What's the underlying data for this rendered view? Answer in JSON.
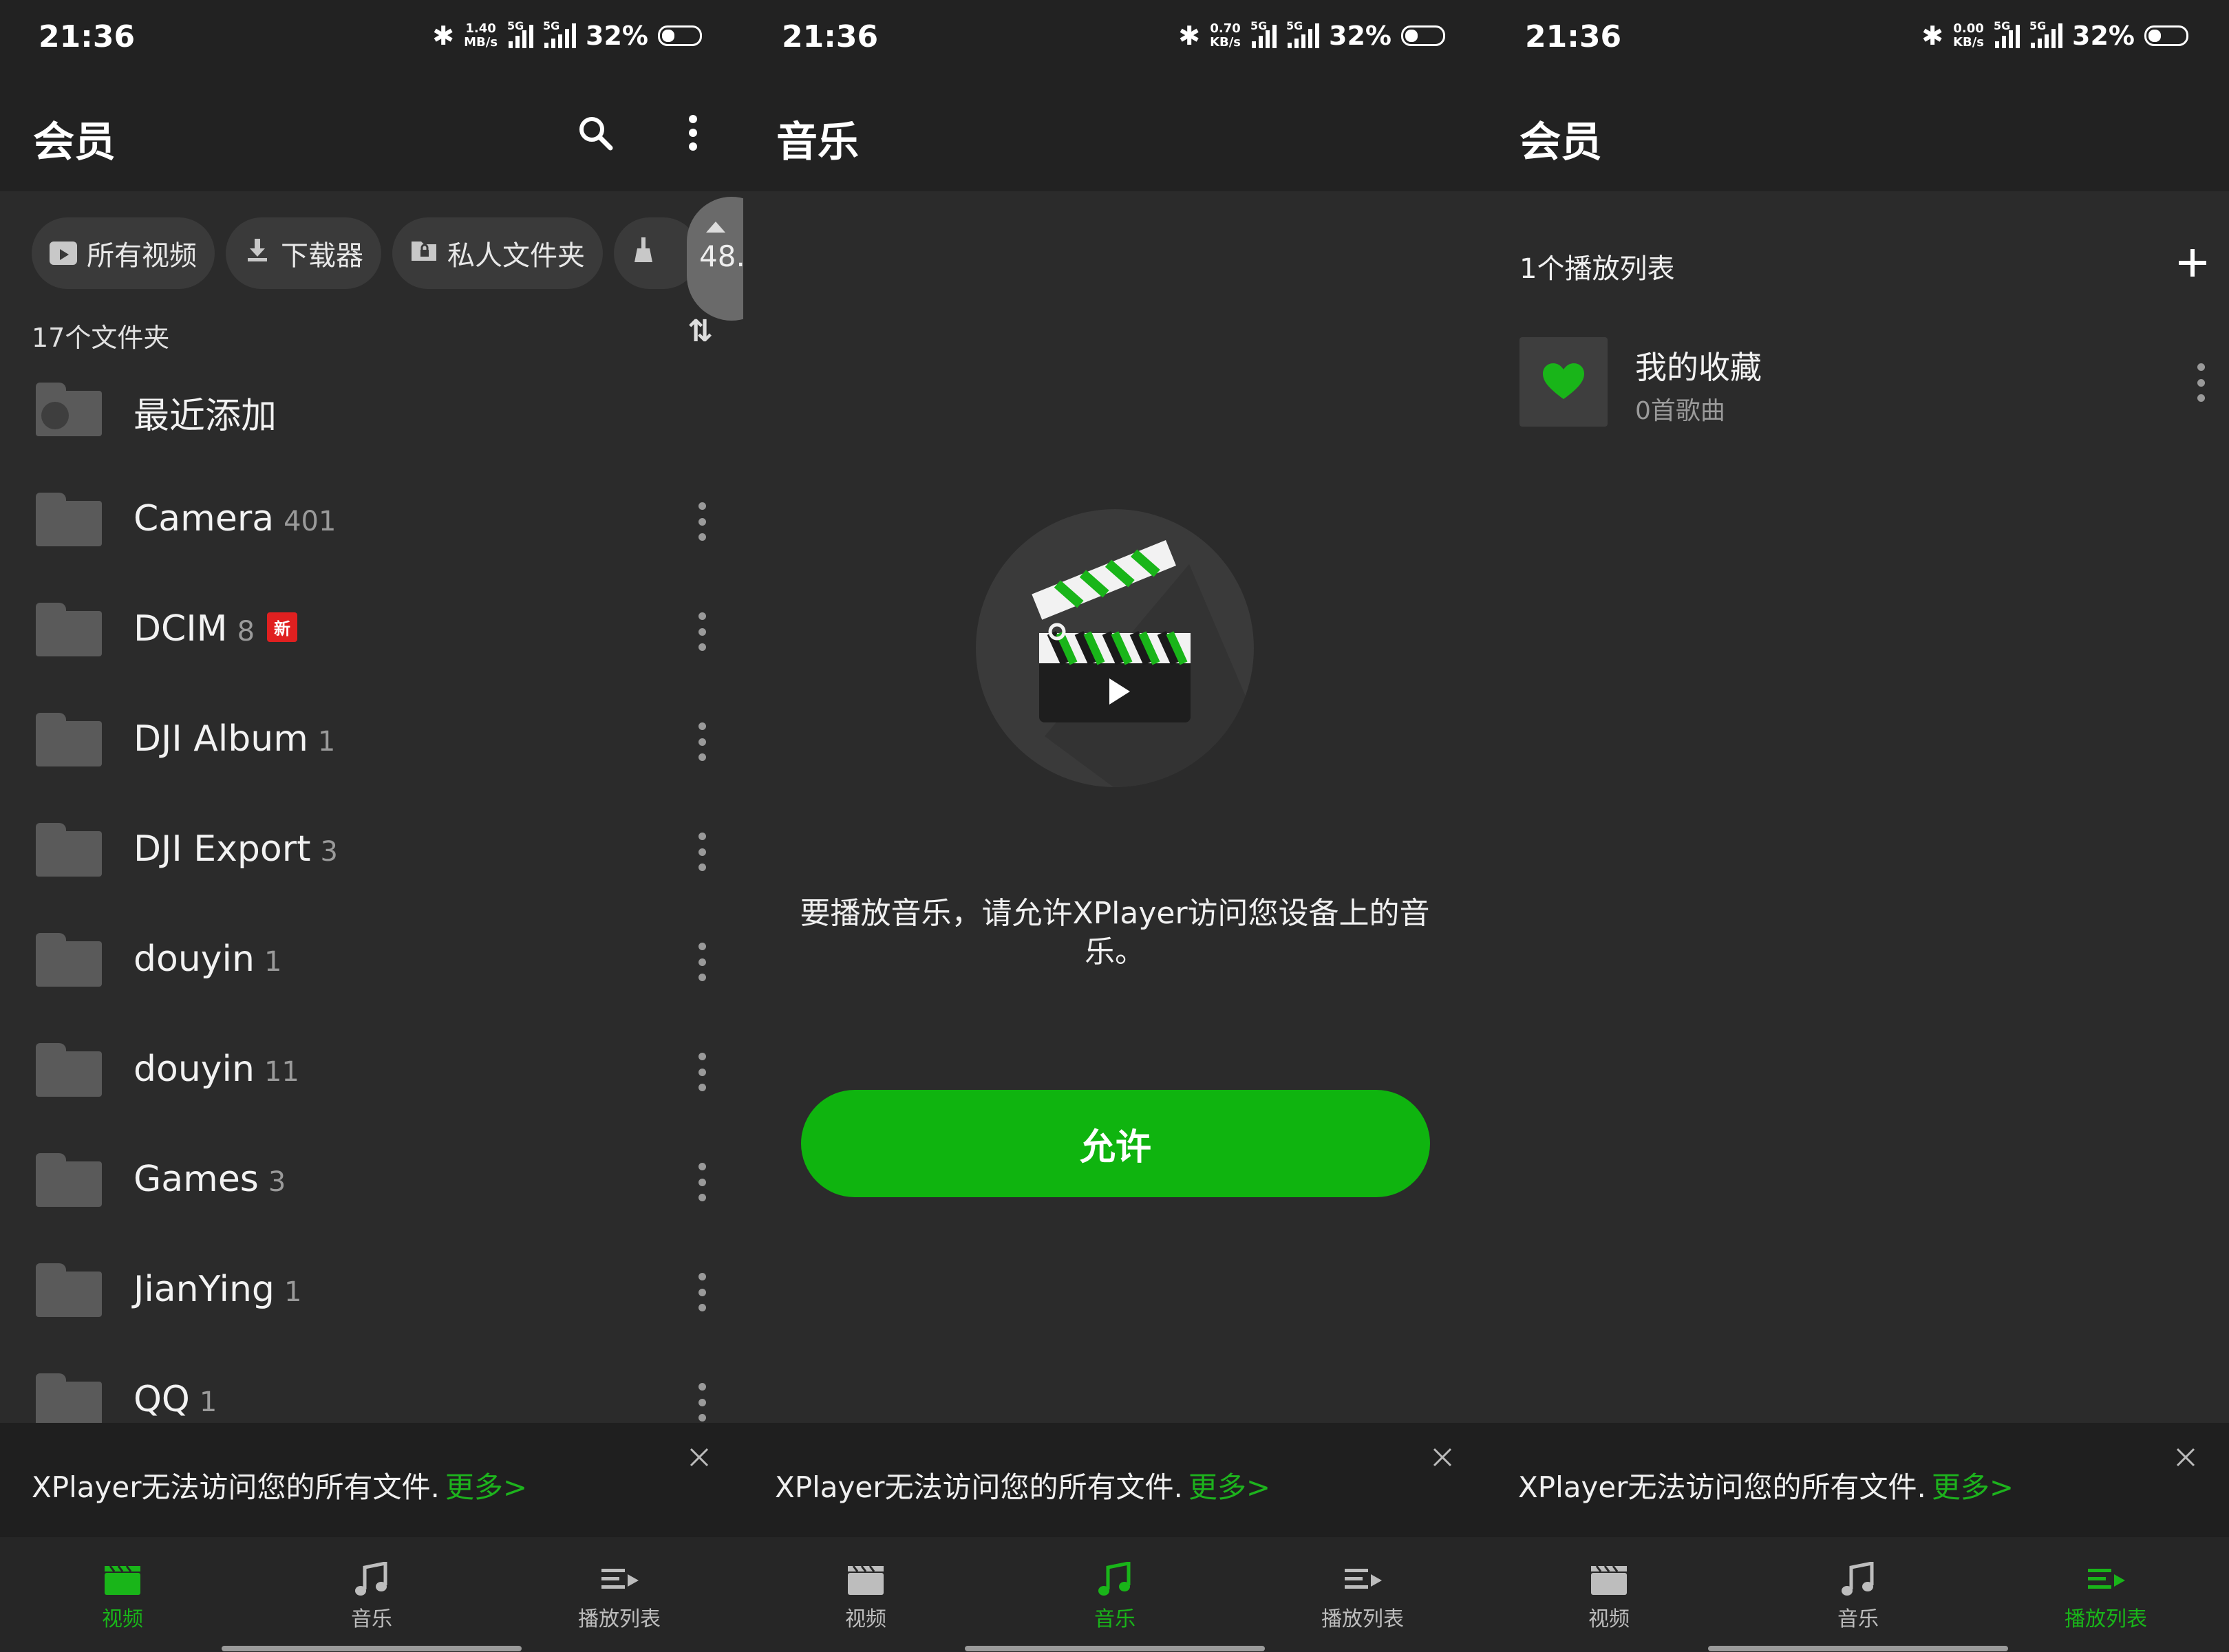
{
  "status": {
    "time": "21:36",
    "battery": "32%",
    "signal_tag": "5G",
    "speeds": [
      {
        "value": "1.40",
        "unit": "MB/s"
      },
      {
        "value": "0.70",
        "unit": "KB/s"
      },
      {
        "value": "0.00",
        "unit": "KB/s"
      }
    ]
  },
  "screen1": {
    "title": "会员",
    "chips": [
      "所有视频",
      "下载器",
      "私人文件夹"
    ],
    "chip_partial": "48.",
    "folder_count_label": "17个文件夹",
    "recent_label": "最近添加",
    "folders": [
      {
        "name": "Camera",
        "count": "401"
      },
      {
        "name": "DCIM",
        "count": "8",
        "badge": "新"
      },
      {
        "name": "DJI Album",
        "count": "1"
      },
      {
        "name": "DJI Export",
        "count": "3"
      },
      {
        "name": "douyin",
        "count": "1"
      },
      {
        "name": "douyin",
        "count": "11"
      },
      {
        "name": "Games",
        "count": "3"
      },
      {
        "name": "JianYing",
        "count": "1"
      },
      {
        "name": "QQ",
        "count": "1"
      }
    ]
  },
  "screen2": {
    "title": "音乐",
    "permission_text": "要播放音乐，请允许XPlayer访问您设备上的音乐。",
    "allow_label": "允许"
  },
  "screen3": {
    "title": "会员",
    "playlist_count": "1个播放列表",
    "playlist_name": "我的收藏",
    "playlist_sub": "0首歌曲"
  },
  "banner": {
    "text": "XPlayer无法访问您的所有文件.",
    "more": "更多>"
  },
  "nav": {
    "video": "视频",
    "music": "音乐",
    "playlist": "播放列表"
  },
  "colors": {
    "accent_green": "#19b519",
    "button_green": "#0fb40f",
    "background": "#2b2b2b",
    "bar": "#222222"
  }
}
